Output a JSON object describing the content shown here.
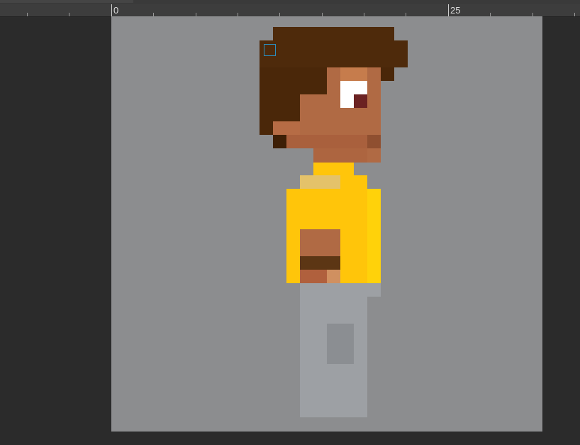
{
  "ruler": {
    "labels": [
      "0",
      "25"
    ]
  },
  "colors": {
    "background": "#2b2b2b",
    "canvas": "#8c8d8f",
    "hair_dark": "#4a2709",
    "hair_mid": "#532d0c",
    "skin": "#b06a44",
    "skin_light": "#c67c4c",
    "skin_shadow": "#8f4f30",
    "eye_white": "#ffffff",
    "eye_pupil": "#6b2222",
    "shirt": "#ffc50a",
    "shirt_light": "#e4c26a",
    "shirt_shadow": "#f7b40a",
    "belt": "#5c3614",
    "pants": "#9da0a4",
    "pants_shadow": "#8b8e92",
    "selection": "#2a8fbf"
  },
  "icons": {
    "cursor": "pixel-cursor-square-icon"
  }
}
